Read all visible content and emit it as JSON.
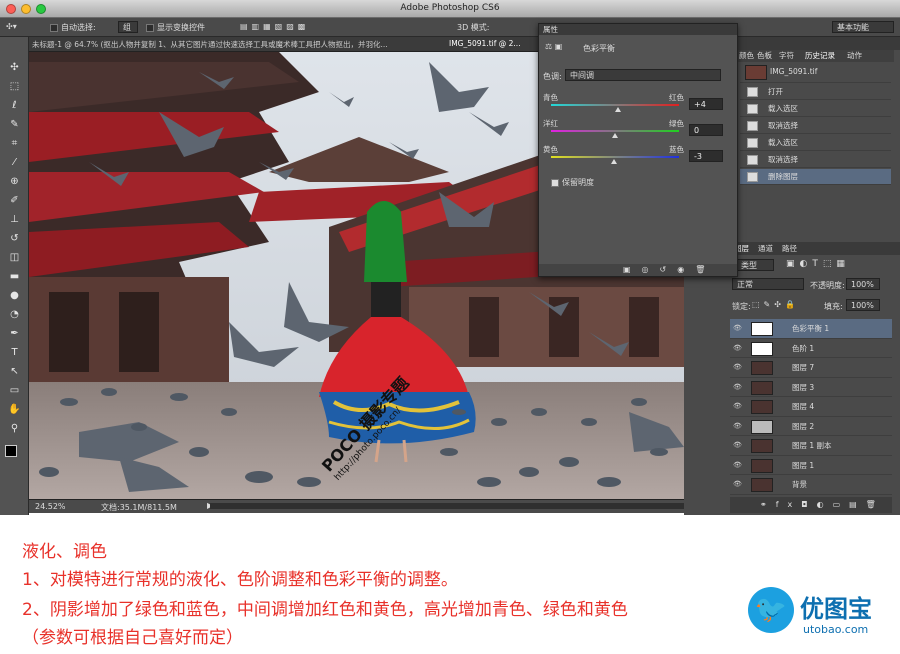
{
  "window": {
    "title": "Adobe Photoshop CS6"
  },
  "options_bar": {
    "auto_select_label": "自动选择:",
    "auto_select_value": "组",
    "show_transform_label": "显示变换控件",
    "mode_3d_label": "3D 模式:",
    "workspace_value": "基本功能"
  },
  "doc_tabs": [
    {
      "label": "未标题-1 @ 64.7% (抠出人物并复制 1、从其它图片通过快速选择工具或魔术棒工具把人物抠出，并羽化..."
    },
    {
      "label": "IMG_5091.tif @ 2..."
    }
  ],
  "status_bar": {
    "zoom": "24.52%",
    "doc_size": "文档:35.1M/811.5M"
  },
  "watermark": {
    "text": "POCO 摄影专题",
    "url": "http://photo.poco.cn/"
  },
  "properties": {
    "tab_label": "属性",
    "panel_title": "色彩平衡",
    "tone_label": "色调:",
    "tone_value": "中间调",
    "sliders": [
      {
        "left": "青色",
        "right": "红色",
        "value": "+4",
        "pos": 0.52,
        "from": "#22d8d8",
        "to": "#e02020"
      },
      {
        "left": "洋红",
        "right": "绿色",
        "value": "0",
        "pos": 0.5,
        "from": "#e020e0",
        "to": "#20d020"
      },
      {
        "left": "黄色",
        "right": "蓝色",
        "value": "-3",
        "pos": 0.49,
        "from": "#e0e020",
        "to": "#2030e0"
      }
    ],
    "preserve_luminosity": "保留明度"
  },
  "right_tabs": [
    "颜色",
    "色板",
    "字符",
    "历史记录",
    "动作"
  ],
  "history": {
    "snapshot": "IMG_5091.tif",
    "items": [
      "打开",
      "载入选区",
      "取消选择",
      "载入选区",
      "取消选择",
      "删除图层"
    ]
  },
  "layers_panel": {
    "tabs": [
      "图层",
      "通道",
      "路径"
    ],
    "filter_value": "类型",
    "blend_mode": "正常",
    "opacity_label": "不透明度:",
    "opacity_value": "100%",
    "lock_label": "锁定:",
    "fill_label": "填充:",
    "fill_value": "100%",
    "layers": [
      "色彩平衡 1",
      "色阶 1",
      "图层 7",
      "图层 3",
      "图层 4",
      "图层 2",
      "图层 1 副本",
      "图层 1",
      "背景"
    ]
  },
  "caption": {
    "title": "液化、调色",
    "line1": "1、对模特进行常规的液化、色阶调整和色彩平衡的调整。",
    "line2": "2、阴影增加了绿色和蓝色，中间调增加红色和黄色，高光增加青色、绿色和黄色",
    "line3": "（参数可根据自己喜好而定）"
  },
  "brand": {
    "name": "优图宝",
    "domain": "utobao.com"
  }
}
